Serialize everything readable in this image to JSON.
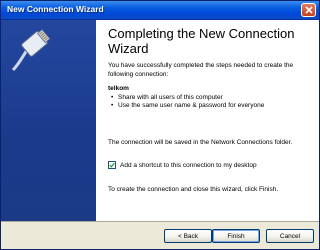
{
  "window": {
    "title": "New Connection Wizard"
  },
  "titlebar": {
    "close_icon": "close-icon"
  },
  "banner": {
    "icon": "network-cable-plug-icon"
  },
  "main": {
    "heading": "Completing the New Connection Wizard",
    "intro": "You have successfully completed the steps needed to create the following connection:",
    "connection_name": "telkom",
    "bullets": [
      "Share with all users of this computer",
      "Use the same user name & password for everyone"
    ],
    "saved_note": "The connection will be saved in the Network Connections folder.",
    "shortcut_label": "Add a shortcut to this connection to my desktop",
    "shortcut_checked": true,
    "finish_note": "To create the connection and close this wizard, click Finish."
  },
  "buttons": {
    "back": "< Back",
    "finish": "Finish",
    "cancel": "Cancel"
  },
  "colors": {
    "titlebar": "#0a5fe0",
    "banner": "#1c3d8f",
    "face": "#ece9d8"
  }
}
